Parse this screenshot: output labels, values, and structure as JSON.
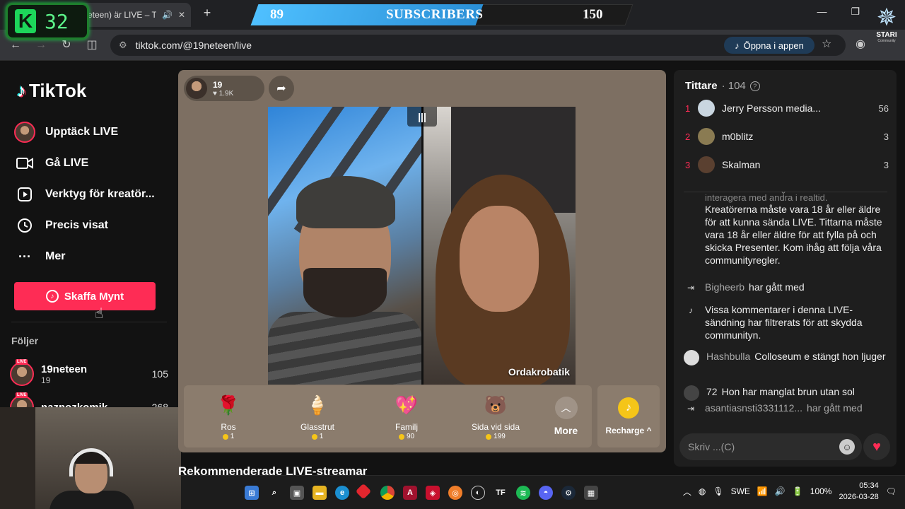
{
  "browser": {
    "tab_title": "eteen) är LIVE – Ti",
    "tab_close": "✕",
    "new_tab": "+",
    "url": "tiktok.com/@19neteen/live",
    "open_in_app": "Öppna i appen"
  },
  "overlay": {
    "k_badge_letter": "K",
    "k_badge_value": "32",
    "subscribers_current": "89",
    "subscribers_label": "SUBSCRIBERS",
    "subscribers_goal": "150",
    "subscribers_progress_fraction": 0.6,
    "brand_name": "STARI",
    "brand_sub": "Community"
  },
  "sidebar": {
    "logo": "TikTok",
    "nav": [
      {
        "label": "Upptäck LIVE",
        "icon": "avatar-icon"
      },
      {
        "label": "Gå LIVE",
        "icon": "video-camera-icon"
      },
      {
        "label": "Verktyg för kreatör...",
        "icon": "creator-tools-icon"
      },
      {
        "label": "Precis visat",
        "icon": "history-icon"
      },
      {
        "label": "Mer",
        "icon": "more-dots-icon"
      }
    ],
    "coins_button": "Skaffa Mynt",
    "follows_title": "Följer",
    "follows": [
      {
        "name": "19neteen",
        "sub": "19",
        "count": "105",
        "live": "LIVE"
      },
      {
        "name": "naznozkomik",
        "sub": "",
        "count": "268",
        "live": "LIVE"
      }
    ]
  },
  "stage": {
    "host_name": "19",
    "host_likes": "1.9K",
    "guest_label": "Ordakrobatik",
    "gifts": [
      {
        "name": "Ros",
        "price": "1",
        "icon": "rose-icon",
        "glyph": "🌹"
      },
      {
        "name": "Glasstrut",
        "price": "1",
        "icon": "ice-cream-icon",
        "glyph": "🍦"
      },
      {
        "name": "Familj",
        "price": "90",
        "icon": "family-heart-icon",
        "glyph": "💖"
      },
      {
        "name": "Sida vid sida",
        "price": "199",
        "icon": "side-by-side-icon",
        "glyph": "🐻"
      }
    ],
    "more_label": "More",
    "recharge_label": "Recharge ^",
    "recharge_icon": "♪"
  },
  "recommend_title": "Rekommenderade LIVE-streamar",
  "right_panel": {
    "viewers_title": "Tittare",
    "viewers_count": "· 104",
    "viewers": [
      {
        "rank": "1",
        "name": "Jerry Persson media...",
        "score": "56",
        "avatar_color": "#c9d6e0"
      },
      {
        "rank": "2",
        "name": "m0blitz",
        "score": "3",
        "avatar_color": "#8a7b52"
      },
      {
        "rank": "3",
        "name": "Skalman",
        "score": "3",
        "avatar_color": "#5a4030"
      }
    ],
    "chat_faded": "interagera med andra i realtid.",
    "chat_rules": "Kreatörerna måste vara 18 år eller äldre för att kunna sända LIVE. Tittarna måste vara 18 år eller äldre för att fylla på och skicka Presenter. Kom ihåg att följa våra communityregler.",
    "joins": [
      {
        "user": "Bigheerb",
        "text": "har gått med"
      },
      {
        "user": "asantiasnsti3331112...",
        "text": "har gått med"
      }
    ],
    "filter_notice": "Vissa kommentarer i denna LIVE-sändning har filtrerats för att skydda communityn.",
    "comments": [
      {
        "user": "Hashbulla",
        "text": "Colloseum e stängt hon ljuger"
      },
      {
        "user": "72",
        "text": "Hon har manglat brun utan sol"
      }
    ],
    "input_placeholder": "Skriv ...(C)"
  },
  "taskbar": {
    "language": "SWE",
    "battery": "100%",
    "time": "05:34",
    "date": "2026-03-28"
  }
}
